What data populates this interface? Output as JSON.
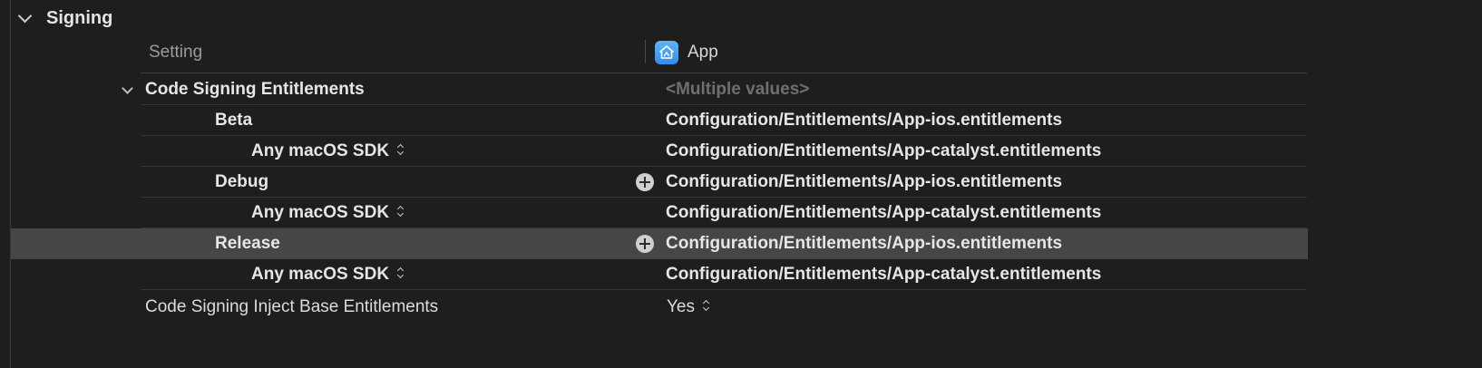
{
  "section": {
    "title": "Signing"
  },
  "columns": {
    "setting": "Setting",
    "target": "App",
    "target_icon": "app-target-icon"
  },
  "rows": {
    "entitlements": {
      "label": "Code Signing Entitlements",
      "value": "<Multiple values>"
    },
    "beta": {
      "label": "Beta",
      "value": "Configuration/Entitlements/App-ios.entitlements"
    },
    "beta_sdk": {
      "label": "Any macOS SDK",
      "value": "Configuration/Entitlements/App-catalyst.entitlements"
    },
    "debug": {
      "label": "Debug",
      "value": "Configuration/Entitlements/App-ios.entitlements"
    },
    "debug_sdk": {
      "label": "Any macOS SDK",
      "value": "Configuration/Entitlements/App-catalyst.entitlements"
    },
    "release": {
      "label": "Release",
      "value": "Configuration/Entitlements/App-ios.entitlements"
    },
    "release_sdk": {
      "label": "Any macOS SDK",
      "value": "Configuration/Entitlements/App-catalyst.entitlements"
    },
    "inject": {
      "label": "Code Signing Inject Base Entitlements",
      "value": "Yes"
    }
  },
  "colors": {
    "selected_row": "#464646",
    "app_icon": "#3d9df2"
  }
}
